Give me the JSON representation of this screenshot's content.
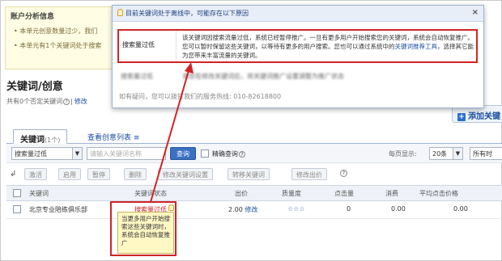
{
  "account": {
    "title": "账户分析信息",
    "lines": [
      "• 本单元创意数量过少，我们",
      "• 本单元有1个关键词处于搜索"
    ]
  },
  "section": {
    "title": "关键词/创意",
    "neg_prefix": "共有0个否定关键词",
    "neg_edit": "修改"
  },
  "add_button": {
    "label": "添加关键"
  },
  "tabs": {
    "active_label": "关键词",
    "active_count": "(1个)",
    "link_label": "查看创意列表"
  },
  "filters": {
    "status_select": "搜索量过低",
    "keyword_placeholder": "请输入关键词名称",
    "query_button": "查询",
    "exact_label": "精确查询",
    "per_page_label": "每页显示:",
    "per_page_value": "20条",
    "time_select": "所有时"
  },
  "actions": [
    "激活",
    "启用",
    "暂停",
    "删除",
    "修改关键词设置",
    "转移关键词",
    "修改出价"
  ],
  "table": {
    "headers": [
      "关键词",
      "关键词状态",
      "出价",
      "质量度",
      "点击量",
      "消费",
      "平均点击价格"
    ],
    "row": {
      "keyword": "北京专业陪练俱乐部",
      "status": "搜索量过低",
      "bid": "2.00",
      "bid_edit": "修改",
      "quality": "☆☆☆",
      "clicks": "0",
      "cost": "0.00",
      "avg_cpc": "0.00"
    }
  },
  "tooltip": {
    "text": "当更多用户开始搜索这些关键词时，系统会自动恢复推广"
  },
  "popup": {
    "title": "目前关键词处于离线中，可能存在以下原因",
    "close": "×",
    "reason_key": "搜索量过低",
    "reason_text_1": "该关键词因搜索流量过低，系统已经暂停推广。一旦有更多用户开始搜索您的关键词，系统会自动恢复推广。您可以暂时保留这些关键词，以等待有更多的用户搜索。您也可以通过系统中的",
    "reason_link": "关键词推荐工具",
    "reason_text_2": "，选择其它能为您带来丰富流量的关键词。",
    "blur_left": "搜索量过低",
    "blur_right": "请您在修改关键词后，将关键词推广设置调整为推广状态",
    "contact": "如有疑问，您可以拨打我们的服务热线: 010-82618800"
  },
  "colors": {
    "accent": "#1a4fa0",
    "highlight": "#d02424",
    "tooltip_bg": "#fff8c4"
  }
}
